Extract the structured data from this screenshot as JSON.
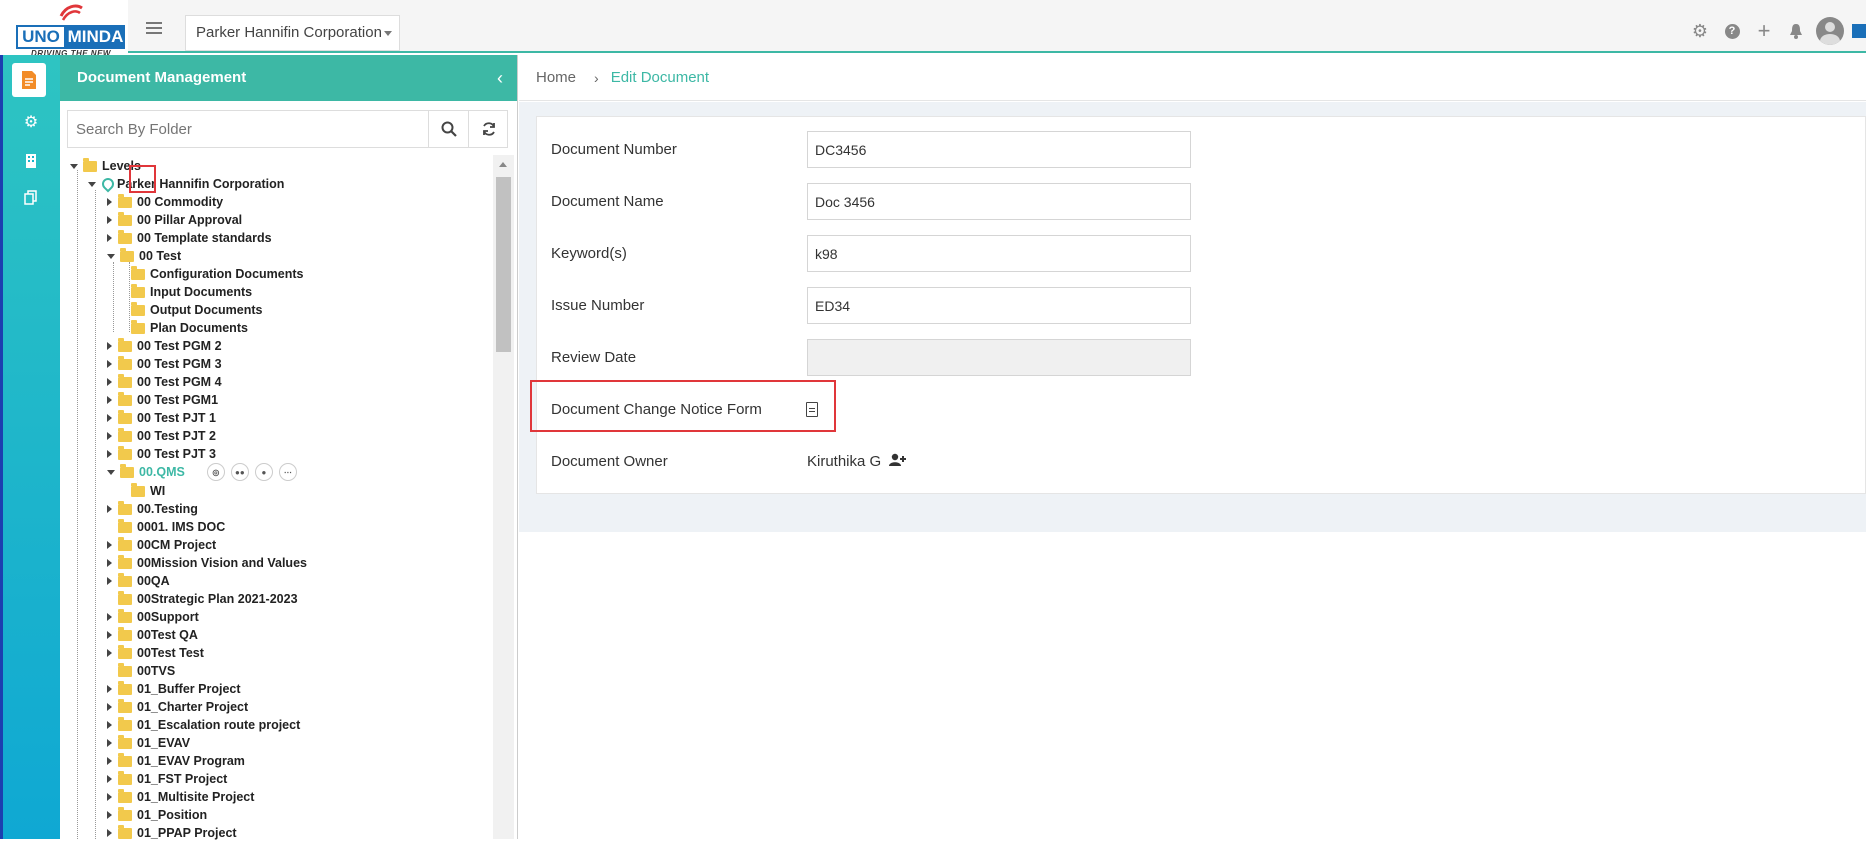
{
  "header": {
    "logo_primary": "UNO",
    "logo_secondary": "MINDA",
    "logo_tagline": "DRIVING THE NEW",
    "org_selector": "Parker Hannifin Corporation",
    "icons": [
      "gear-icon",
      "help-icon",
      "plus-icon",
      "bell-icon",
      "avatar"
    ]
  },
  "rail": {
    "items": [
      "document-icon",
      "settings-icon",
      "building-icon",
      "copy-icon"
    ]
  },
  "panel": {
    "title": "Document Management",
    "search_placeholder": "Search By Folder",
    "tree": {
      "root": "Levels",
      "org": "Parker Hannifin Corporation",
      "items": [
        {
          "label": "00 Commodity"
        },
        {
          "label": "00 Pillar Approval"
        },
        {
          "label": "00 Template standards"
        },
        {
          "label": "00 Test"
        },
        {
          "label": "Configuration Documents"
        },
        {
          "label": "Input Documents"
        },
        {
          "label": "Output Documents"
        },
        {
          "label": "Plan Documents"
        },
        {
          "label": "00 Test PGM 2"
        },
        {
          "label": "00 Test PGM 3"
        },
        {
          "label": "00 Test PGM 4"
        },
        {
          "label": "00 Test PGM1"
        },
        {
          "label": "00 Test PJT 1"
        },
        {
          "label": "00 Test PJT 2"
        },
        {
          "label": "00 Test PJT 3"
        },
        {
          "label": "00.QMS"
        },
        {
          "label": "WI"
        },
        {
          "label": "00.Testing"
        },
        {
          "label": "0001. IMS DOC"
        },
        {
          "label": "00CM Project"
        },
        {
          "label": "00Mission Vision and Values"
        },
        {
          "label": "00QA"
        },
        {
          "label": "00Strategic Plan 2021-2023"
        },
        {
          "label": "00Support"
        },
        {
          "label": "00Test QA"
        },
        {
          "label": "00Test Test"
        },
        {
          "label": "00TVS"
        },
        {
          "label": "01_Buffer Project"
        },
        {
          "label": "01_Charter Project"
        },
        {
          "label": "01_Escalation route project"
        },
        {
          "label": "01_EVAV"
        },
        {
          "label": "01_EVAV Program"
        },
        {
          "label": "01_FST Project"
        },
        {
          "label": "01_Multisite Project"
        },
        {
          "label": "01_Position"
        },
        {
          "label": "01_PPAP Project"
        }
      ]
    }
  },
  "breadcrumb": {
    "home": "Home",
    "current": "Edit Document"
  },
  "form": {
    "document_number_label": "Document Number",
    "document_number_value": "DC3456",
    "document_name_label": "Document Name",
    "document_name_value": "Doc 3456",
    "keywords_label": "Keyword(s)",
    "keywords_value": "k98",
    "issue_number_label": "Issue Number",
    "issue_number_value": "ED34",
    "review_date_label": "Review Date",
    "review_date_value": "",
    "change_notice_label": "Document Change Notice Form",
    "owner_label": "Document Owner",
    "owner_value": "Kiruthika G"
  },
  "colors": {
    "accent": "#3db8a5",
    "highlight": "#e0363a",
    "folder": "#f2c94c"
  }
}
